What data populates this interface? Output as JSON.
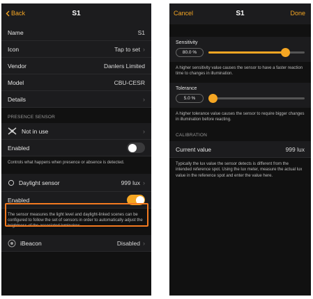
{
  "left": {
    "nav": {
      "back": "Back",
      "title": "S1"
    },
    "rows": [
      {
        "label": "Name",
        "value": "S1"
      },
      {
        "label": "Icon",
        "value": "Tap to set"
      },
      {
        "label": "Vendor",
        "value": "Danlers Limited"
      },
      {
        "label": "Model",
        "value": "CBU-CESR"
      },
      {
        "label": "Details",
        "value": ""
      }
    ],
    "presence": {
      "header": "PRESENCE SENSOR",
      "mode": "Not in use",
      "enabled_label": "Enabled",
      "enabled": false,
      "note": "Controls what happens when presence or absence is detected."
    },
    "daylight": {
      "label": "Daylight sensor",
      "value": "999 lux",
      "enabled_label": "Enabled",
      "enabled": true,
      "note": "The sensor measures the light level and daylight-linked scenes can be configured to follow the set of sensors in order to automatically adjust the brightness of the associated luminaires."
    },
    "ibeacon": {
      "label": "iBeacon",
      "value": "Disabled"
    }
  },
  "right": {
    "nav": {
      "cancel": "Cancel",
      "title": "S1",
      "done": "Done"
    },
    "sensitivity": {
      "title": "Sensitivity",
      "value_text": "80.0 %",
      "level": 0.8,
      "note": "A higher sensitivity value causes the sensor to have a faster reaction time to changes in illumination."
    },
    "tolerance": {
      "title": "Tolerance",
      "value_text": "5.0 %",
      "level": 0.05,
      "note": "A higher tolerance value causes the sensor to require bigger changes in illumination before reacting."
    },
    "calibration": {
      "header": "CALIBRATION",
      "label": "Current value",
      "value": "999 lux",
      "note": "Typically the lux value the sensor detects is different from the intended reference spot. Using the lux meter, measure the actual lux value in the reference spot and enter the value here."
    }
  },
  "colors": {
    "accent": "#f5a623",
    "highlight": "#f47a20",
    "background": "#111111"
  }
}
